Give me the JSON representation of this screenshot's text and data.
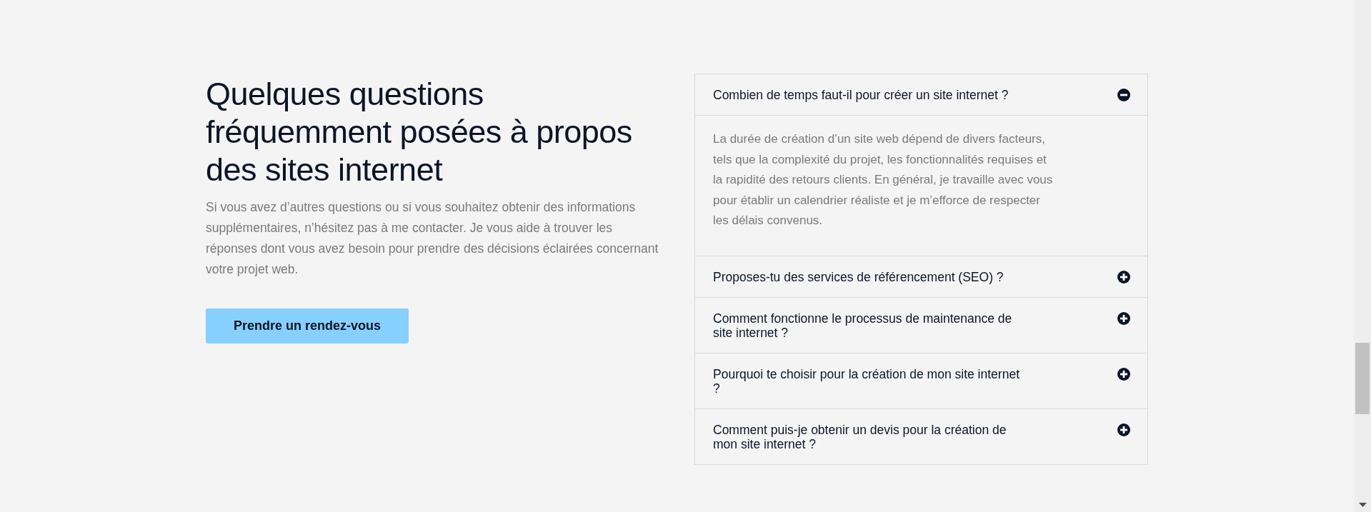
{
  "intro": {
    "heading": "Quelques questions fréquemment posées à propos des sites internet",
    "text": "Si vous avez d’autres questions ou si vous souhaitez obtenir des informations supplémentaires, n’hésitez pas à me contacter. Je vous aide à trouver les réponses dont vous avez besoin pour prendre des décisions éclairées concernant votre projet web.",
    "button": "Prendre un rendez-vous"
  },
  "faq": [
    {
      "question": "Combien de temps faut-il pour créer un site internet ?",
      "expanded": true,
      "answer": "La durée de création d’un site web dépend de divers facteurs, tels que la complexité du projet, les fonctionnalités requises et la rapidité des retours clients. En général, je travaille avec vous pour établir un calendrier réaliste et je m’efforce de respecter les délais convenus."
    },
    {
      "question": "Proposes-tu des services de référencement (SEO) ?",
      "expanded": false
    },
    {
      "question": "Comment fonctionne le processus de maintenance de site internet ?",
      "expanded": false
    },
    {
      "question": "Pourquoi te choisir pour la création de mon site internet ?",
      "expanded": false
    },
    {
      "question": "Comment puis-je obtenir un devis pour la création de mon site internet ?",
      "expanded": false
    }
  ]
}
